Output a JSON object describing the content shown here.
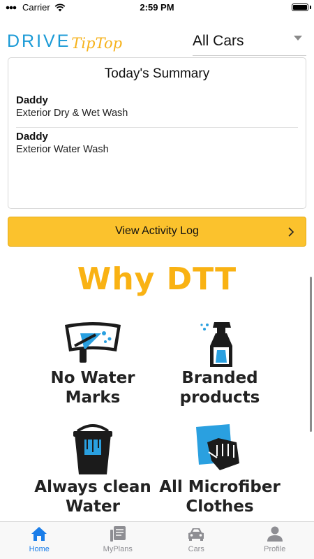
{
  "status_bar": {
    "carrier": "Carrier",
    "time": "2:59 PM"
  },
  "header": {
    "logo_drive": "DRIVE",
    "logo_tiptop": "TipTop",
    "car_filter": {
      "selected": "All Cars"
    }
  },
  "summary": {
    "title": "Today's Summary",
    "entries": [
      {
        "name": "Daddy",
        "service": "Exterior Dry & Wet Wash"
      },
      {
        "name": "Daddy",
        "service": "Exterior Water Wash"
      }
    ]
  },
  "activity_button": {
    "label": "View Activity Log"
  },
  "why": {
    "title": "Why DTT",
    "features": [
      {
        "line1": "No Water",
        "line2": "Marks",
        "icon": "windshield-icon"
      },
      {
        "line1": "Branded",
        "line2": "products",
        "icon": "spray-bottle-icon"
      },
      {
        "line1": "Always clean",
        "line2": "Water",
        "icon": "bucket-icon"
      },
      {
        "line1": "All Microfiber",
        "line2": "Clothes",
        "icon": "microfiber-cloth-icon"
      }
    ]
  },
  "tabs": [
    {
      "label": "Home",
      "icon": "home-icon",
      "active": true
    },
    {
      "label": "MyPlans",
      "icon": "plans-icon",
      "active": false
    },
    {
      "label": "Cars",
      "icon": "car-icon",
      "active": false
    },
    {
      "label": "Profile",
      "icon": "profile-icon",
      "active": false
    }
  ],
  "colors": {
    "accent_yellow": "#fbc22d",
    "brand_blue": "#1a9ad6",
    "tab_active": "#1a7de9"
  }
}
